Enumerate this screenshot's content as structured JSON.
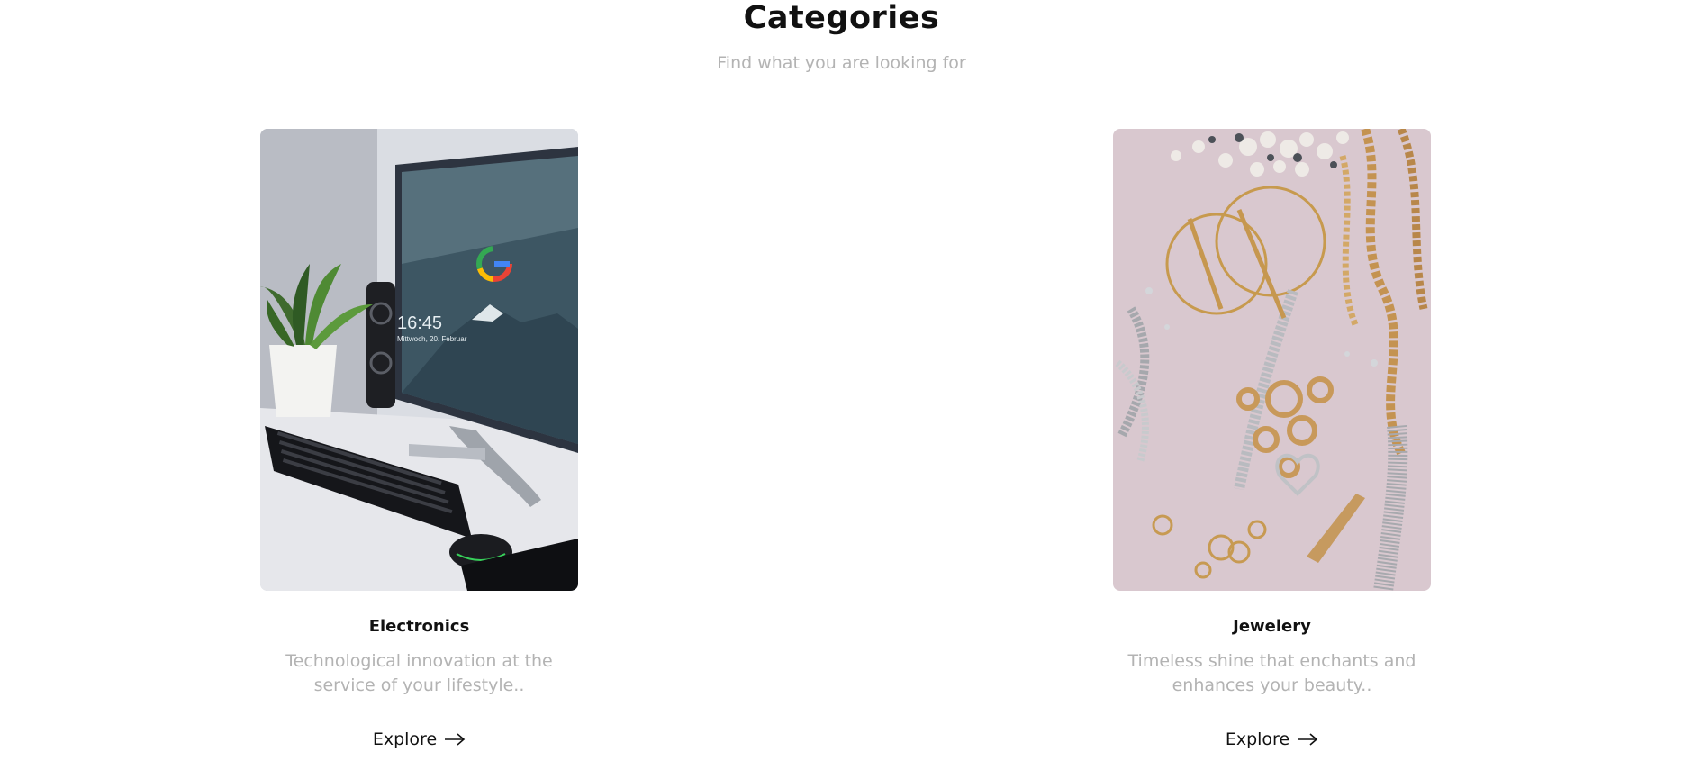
{
  "header": {
    "title": "Categories",
    "subtitle": "Find what you are looking for"
  },
  "categories": [
    {
      "name": "Electronics",
      "description": "Technological innovation at the service of your lifestyle..",
      "cta_label": "Explore",
      "image_alt": "Computer monitor, keyboard and mouse on a desk",
      "monitor_time": "16:45",
      "monitor_date": "Mittwoch, 20. Februar"
    },
    {
      "name": "Jewelery",
      "description": "Timeless shine that enchants and enhances your beauty..",
      "cta_label": "Explore",
      "image_alt": "Gold and silver jewelry spread on a pink surface"
    }
  ],
  "icons": {
    "arrow": "arrow-right-icon"
  },
  "colors": {
    "text": "#111111",
    "muted": "#b3b3b3",
    "background": "#ffffff"
  }
}
